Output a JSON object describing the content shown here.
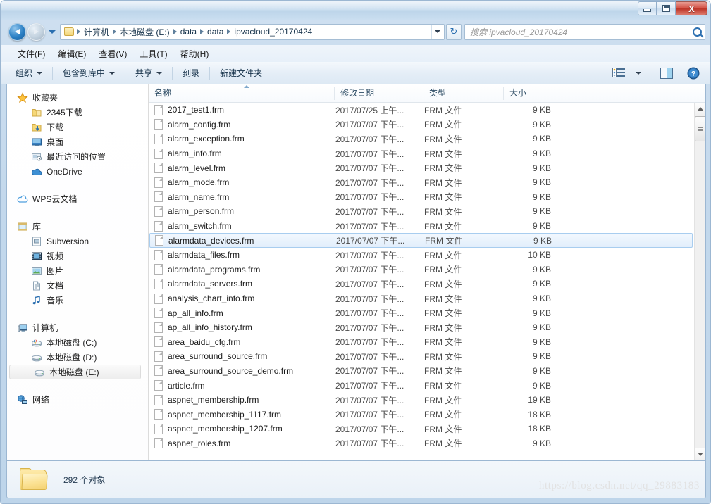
{
  "window": {
    "title": "",
    "controls": {
      "minimize": "",
      "maximize": "",
      "close": "X"
    }
  },
  "address": {
    "back_label": "",
    "forward_label": "",
    "crumbs": [
      "计算机",
      "本地磁盘 (E:)",
      "data",
      "data",
      "ipvacloud_20170424"
    ],
    "refresh_label": "↻"
  },
  "search": {
    "placeholder": "搜索 ipvacloud_20170424"
  },
  "menubar": {
    "items": [
      "文件(F)",
      "编辑(E)",
      "查看(V)",
      "工具(T)",
      "帮助(H)"
    ]
  },
  "toolbar": {
    "items": [
      {
        "label": "组织",
        "caret": true
      },
      {
        "label": "包含到库中",
        "caret": true
      },
      {
        "label": "共享",
        "caret": true
      },
      {
        "label": "刻录",
        "caret": false
      },
      {
        "label": "新建文件夹",
        "caret": false
      }
    ],
    "view_icon": "list-view-icon",
    "view_caret": "chevron-down-icon",
    "preview_icon": "preview-pane-icon",
    "help_icon": "help-icon"
  },
  "sidebar": {
    "groups": [
      {
        "head": {
          "label": "收藏夹",
          "icon": "star-icon"
        },
        "items": [
          {
            "label": "2345下载",
            "icon": "folder-icon"
          },
          {
            "label": "下载",
            "icon": "download-folder-icon"
          },
          {
            "label": "桌面",
            "icon": "desktop-icon"
          },
          {
            "label": "最近访问的位置",
            "icon": "recent-places-icon"
          },
          {
            "label": "OneDrive",
            "icon": "onedrive-cloud-icon"
          }
        ]
      },
      {
        "head": {
          "label": "WPS云文档",
          "icon": "wps-cloud-icon"
        },
        "items": []
      },
      {
        "head": {
          "label": "库",
          "icon": "library-icon"
        },
        "items": [
          {
            "label": "Subversion",
            "icon": "subversion-icon"
          },
          {
            "label": "视频",
            "icon": "video-icon"
          },
          {
            "label": "图片",
            "icon": "picture-icon"
          },
          {
            "label": "文档",
            "icon": "document-icon"
          },
          {
            "label": "音乐",
            "icon": "music-icon"
          }
        ]
      },
      {
        "head": {
          "label": "计算机",
          "icon": "computer-icon"
        },
        "items": [
          {
            "label": "本地磁盘 (C:)",
            "icon": "system-drive-icon",
            "selected": false
          },
          {
            "label": "本地磁盘 (D:)",
            "icon": "drive-icon",
            "selected": false
          },
          {
            "label": "本地磁盘 (E:)",
            "icon": "drive-icon",
            "selected": true
          }
        ]
      },
      {
        "head": {
          "label": "网络",
          "icon": "network-icon"
        },
        "items": []
      }
    ]
  },
  "filelist": {
    "columns": [
      {
        "label": "名称",
        "sorted": true
      },
      {
        "label": "修改日期",
        "sorted": false
      },
      {
        "label": "类型",
        "sorted": false
      },
      {
        "label": "大小",
        "sorted": false
      }
    ],
    "rows": [
      {
        "name": "2017_test1.frm",
        "date": "2017/07/25 上午...",
        "type": "FRM 文件",
        "size": "9 KB",
        "selected": false
      },
      {
        "name": "alarm_config.frm",
        "date": "2017/07/07 下午...",
        "type": "FRM 文件",
        "size": "9 KB",
        "selected": false
      },
      {
        "name": "alarm_exception.frm",
        "date": "2017/07/07 下午...",
        "type": "FRM 文件",
        "size": "9 KB",
        "selected": false
      },
      {
        "name": "alarm_info.frm",
        "date": "2017/07/07 下午...",
        "type": "FRM 文件",
        "size": "9 KB",
        "selected": false
      },
      {
        "name": "alarm_level.frm",
        "date": "2017/07/07 下午...",
        "type": "FRM 文件",
        "size": "9 KB",
        "selected": false
      },
      {
        "name": "alarm_mode.frm",
        "date": "2017/07/07 下午...",
        "type": "FRM 文件",
        "size": "9 KB",
        "selected": false
      },
      {
        "name": "alarm_name.frm",
        "date": "2017/07/07 下午...",
        "type": "FRM 文件",
        "size": "9 KB",
        "selected": false
      },
      {
        "name": "alarm_person.frm",
        "date": "2017/07/07 下午...",
        "type": "FRM 文件",
        "size": "9 KB",
        "selected": false
      },
      {
        "name": "alarm_switch.frm",
        "date": "2017/07/07 下午...",
        "type": "FRM 文件",
        "size": "9 KB",
        "selected": false
      },
      {
        "name": "alarmdata_devices.frm",
        "date": "2017/07/07 下午...",
        "type": "FRM 文件",
        "size": "9 KB",
        "selected": true
      },
      {
        "name": "alarmdata_files.frm",
        "date": "2017/07/07 下午...",
        "type": "FRM 文件",
        "size": "10 KB",
        "selected": false
      },
      {
        "name": "alarmdata_programs.frm",
        "date": "2017/07/07 下午...",
        "type": "FRM 文件",
        "size": "9 KB",
        "selected": false
      },
      {
        "name": "alarmdata_servers.frm",
        "date": "2017/07/07 下午...",
        "type": "FRM 文件",
        "size": "9 KB",
        "selected": false
      },
      {
        "name": "analysis_chart_info.frm",
        "date": "2017/07/07 下午...",
        "type": "FRM 文件",
        "size": "9 KB",
        "selected": false
      },
      {
        "name": "ap_all_info.frm",
        "date": "2017/07/07 下午...",
        "type": "FRM 文件",
        "size": "9 KB",
        "selected": false
      },
      {
        "name": "ap_all_info_history.frm",
        "date": "2017/07/07 下午...",
        "type": "FRM 文件",
        "size": "9 KB",
        "selected": false
      },
      {
        "name": "area_baidu_cfg.frm",
        "date": "2017/07/07 下午...",
        "type": "FRM 文件",
        "size": "9 KB",
        "selected": false
      },
      {
        "name": "area_surround_source.frm",
        "date": "2017/07/07 下午...",
        "type": "FRM 文件",
        "size": "9 KB",
        "selected": false
      },
      {
        "name": "area_surround_source_demo.frm",
        "date": "2017/07/07 下午...",
        "type": "FRM 文件",
        "size": "9 KB",
        "selected": false
      },
      {
        "name": "article.frm",
        "date": "2017/07/07 下午...",
        "type": "FRM 文件",
        "size": "9 KB",
        "selected": false
      },
      {
        "name": "aspnet_membership.frm",
        "date": "2017/07/07 下午...",
        "type": "FRM 文件",
        "size": "19 KB",
        "selected": false
      },
      {
        "name": "aspnet_membership_1117.frm",
        "date": "2017/07/07 下午...",
        "type": "FRM 文件",
        "size": "18 KB",
        "selected": false
      },
      {
        "name": "aspnet_membership_1207.frm",
        "date": "2017/07/07 下午...",
        "type": "FRM 文件",
        "size": "18 KB",
        "selected": false
      },
      {
        "name": "aspnet_roles.frm",
        "date": "2017/07/07 下午...",
        "type": "FRM 文件",
        "size": "9 KB",
        "selected": false
      }
    ]
  },
  "statusbar": {
    "text": "292 个对象",
    "folder_icon": "folder-icon"
  },
  "watermark": {
    "text": "https://blog.csdn.net/qq_29883183"
  },
  "colors": {
    "accent": "#2b6fb0",
    "selection_bg": "#e2eefb",
    "selection_border": "#a8cdef",
    "frame": "#9cb7d2",
    "close_button": "#bc3528"
  }
}
